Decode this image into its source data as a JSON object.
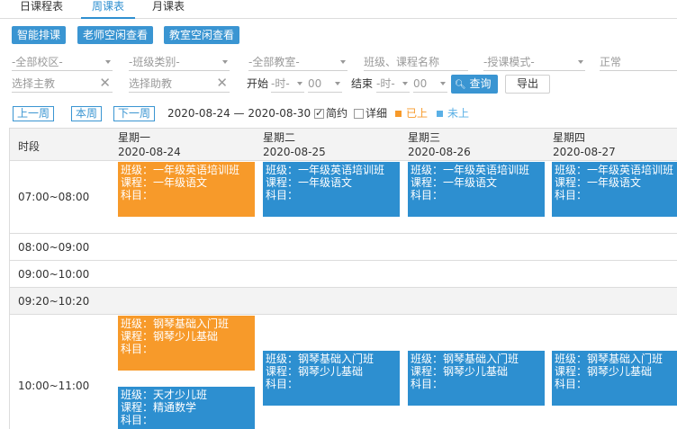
{
  "tabs": [
    {
      "label": "日课程表"
    },
    {
      "label": "周课表"
    },
    {
      "label": "月课表"
    }
  ],
  "actions": {
    "smart_schedule": "智能排课",
    "teacher_free": "老师空闲查看",
    "room_free": "教室空闲查看"
  },
  "filters": {
    "campus": "-全部校区-",
    "class_type": "-班级类别-",
    "room": "-全部教室-",
    "class_course_placeholder": "班级、课程名称",
    "teach_mode": "-授课模式-",
    "status": "正常",
    "main_teacher_placeholder": "选择主教",
    "assistant_placeholder": "选择助教",
    "start_label": "开始",
    "start_hour": "-时-",
    "start_min": "00",
    "end_label": "结束",
    "end_hour": "-时-",
    "end_min": "00",
    "query": "查询",
    "export": "导出"
  },
  "nav": {
    "prev": "上一周",
    "this": "本周",
    "next": "下一周",
    "range": "2020-08-24 — 2020-08-30",
    "brief": "简约",
    "detail": "详细",
    "legend_done": "已上",
    "legend_todo": "未上",
    "done_color": "#f79a2a",
    "todo_color": "#2d8fd0"
  },
  "grid": {
    "time_header": "时段",
    "days": [
      {
        "weekday": "星期一",
        "date": "2020-08-24"
      },
      {
        "weekday": "星期二",
        "date": "2020-08-25"
      },
      {
        "weekday": "星期三",
        "date": "2020-08-26"
      },
      {
        "weekday": "星期四",
        "date": "2020-08-27"
      }
    ],
    "slots": [
      {
        "time": "07:00~08:00"
      },
      {
        "time": "08:00~09:00"
      },
      {
        "time": "09:00~10:00"
      },
      {
        "time": "09:20~10:20"
      },
      {
        "time": "10:00~11:00"
      }
    ],
    "cards": [
      {
        "status": "done",
        "class": "班级：一年级英语培训班",
        "course": "课程：一年级语文",
        "subject": "科目："
      },
      {
        "status": "todo",
        "class": "班级：一年级英语培训班",
        "course": "课程：一年级语文",
        "subject": "科目："
      },
      {
        "status": "todo",
        "class": "班级：一年级英语培训班",
        "course": "课程：一年级语文",
        "subject": "科目："
      },
      {
        "status": "todo",
        "class": "班级：一年级英语培训班",
        "course": "课程：一年级语文",
        "subject": "科目："
      },
      {
        "status": "done",
        "class": "班级：钢琴基础入门班",
        "course": "课程：钢琴少儿基础",
        "subject": "科目："
      },
      {
        "status": "todo",
        "class": "班级：天才少儿班",
        "course": "课程：精通数学",
        "subject": "科目："
      },
      {
        "status": "todo",
        "class": "班级：钢琴基础入门班",
        "course": "课程：钢琴少儿基础",
        "subject": "科目："
      },
      {
        "status": "todo",
        "class": "班级：钢琴基础入门班",
        "course": "课程：钢琴少儿基础",
        "subject": "科目："
      },
      {
        "status": "todo",
        "class": "班级：钢琴基础入门班",
        "course": "课程：钢琴少儿基础",
        "subject": "科目："
      }
    ]
  }
}
